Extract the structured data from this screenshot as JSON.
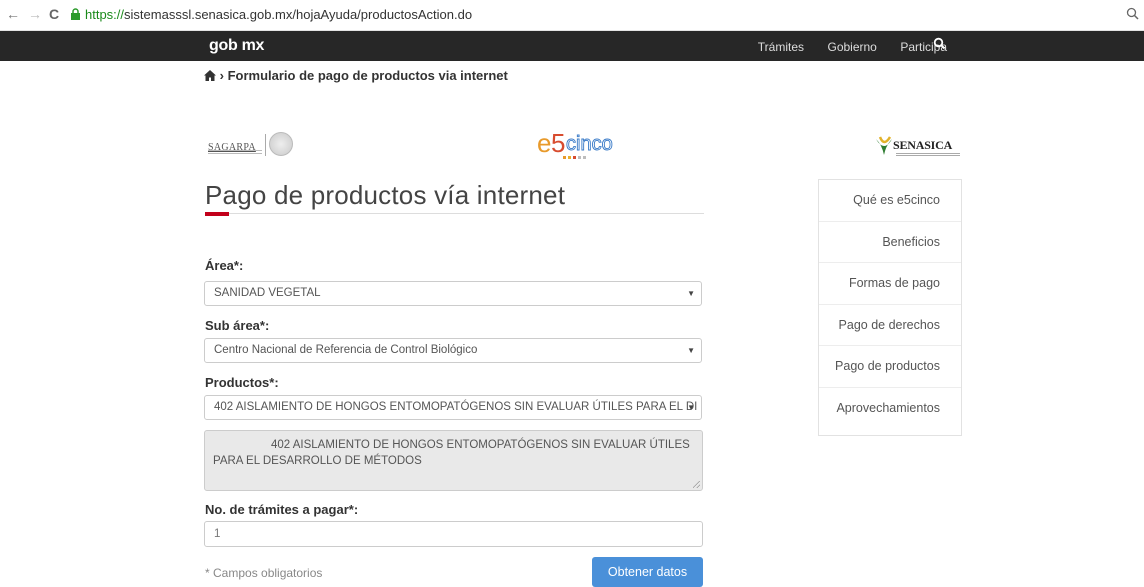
{
  "browser": {
    "url_scheme": "https://",
    "url_rest": "sistemasssl.senasica.gob.mx/hojaAyuda/productosAction.do",
    "back": "←",
    "forward": "→",
    "reload": "C"
  },
  "header": {
    "logo": "gob mx",
    "nav": [
      "Trámites",
      "Gobierno",
      "Participa"
    ]
  },
  "breadcrumb": {
    "text": "Formulario de pago de productos via internet"
  },
  "logos": {
    "sagarpa": "SAGARPA",
    "e5": "e5cinco",
    "senasica": "SENASICA"
  },
  "main": {
    "title": "Pago de productos vía internet",
    "area_label": "Área*:",
    "area_value": "SANIDAD VEGETAL",
    "subarea_label": "Sub área*:",
    "subarea_value": "Centro Nacional de Referencia de Control Biológico",
    "productos_label": "Productos*:",
    "productos_value": "402 AISLAMIENTO DE HONGOS ENTOMOPATÓGENOS SIN EVALUAR ÚTILES PARA EL DI",
    "description": "402 AISLAMIENTO DE HONGOS ENTOMOPATÓGENOS SIN EVALUAR ÚTILES PARA EL DESARROLLO DE MÉTODOS",
    "tramites_label": "No. de trámites a pagar*:",
    "tramites_value": "1",
    "required_note": "* Campos obligatorios",
    "submit_label": "Obtener datos"
  },
  "sidebar": {
    "items": [
      {
        "label": "Qué es e5cinco"
      },
      {
        "label": "Beneficios"
      },
      {
        "label": "Formas de pago"
      },
      {
        "label": "Pago de derechos"
      },
      {
        "label": "Pago de productos"
      },
      {
        "label": "Aprovechamientos"
      }
    ]
  },
  "colors": {
    "accent": "#c2001b",
    "button": "#4a90d9",
    "header": "#272727"
  }
}
